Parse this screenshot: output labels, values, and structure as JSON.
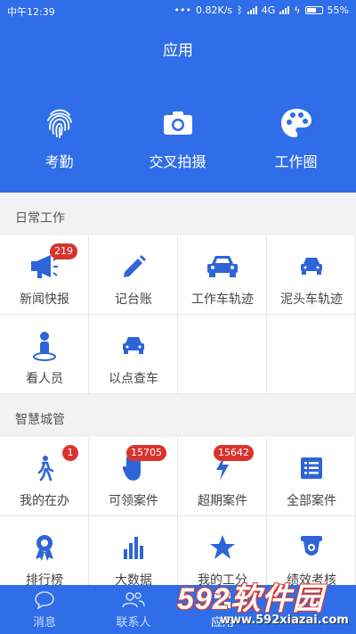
{
  "status": {
    "time": "中午12:39",
    "speed": "0.82K/s",
    "network": "4G",
    "battery": "55%"
  },
  "header": {
    "title": "应用",
    "actions": [
      {
        "label": "考勤",
        "icon": "fingerprint-icon"
      },
      {
        "label": "交叉拍摄",
        "icon": "camera-icon"
      },
      {
        "label": "工作圈",
        "icon": "palette-icon"
      }
    ]
  },
  "sections": [
    {
      "title": "日常工作",
      "items": [
        {
          "label": "新闻快报",
          "icon": "megaphone-icon",
          "badge": "219"
        },
        {
          "label": "记台账",
          "icon": "pencil-icon"
        },
        {
          "label": "工作车轨迹",
          "icon": "car-icon"
        },
        {
          "label": "泥头车轨迹",
          "icon": "truck-icon"
        },
        {
          "label": "看人员",
          "icon": "person-pin-icon"
        },
        {
          "label": "以点查车",
          "icon": "car-search-icon"
        }
      ]
    },
    {
      "title": "智慧城管",
      "items": [
        {
          "label": "我的在办",
          "icon": "walking-icon",
          "badge": "1"
        },
        {
          "label": "可领案件",
          "icon": "hand-icon",
          "badge": "15705"
        },
        {
          "label": "超期案件",
          "icon": "lightning-icon",
          "badge": "15642"
        },
        {
          "label": "全部案件",
          "icon": "list-icon"
        },
        {
          "label": "排行榜",
          "icon": "ribbon-icon"
        },
        {
          "label": "大数据",
          "icon": "bar-chart-icon"
        },
        {
          "label": "我的工分",
          "icon": "star-icon"
        },
        {
          "label": "绩效考核",
          "icon": "badge-icon"
        }
      ]
    }
  ],
  "bottom_nav": [
    {
      "label": "消息",
      "icon": "chat-icon"
    },
    {
      "label": "联系人",
      "icon": "contacts-icon"
    },
    {
      "label": "应用",
      "icon": "apps-icon"
    }
  ],
  "watermark": {
    "logo": "592软件园",
    "url": "www.592xiazai.com"
  },
  "colors": {
    "primary": "#2f6ee8",
    "icon": "#2d65d8",
    "badge": "#d9332e",
    "section_bg": "#f2f2f2"
  }
}
